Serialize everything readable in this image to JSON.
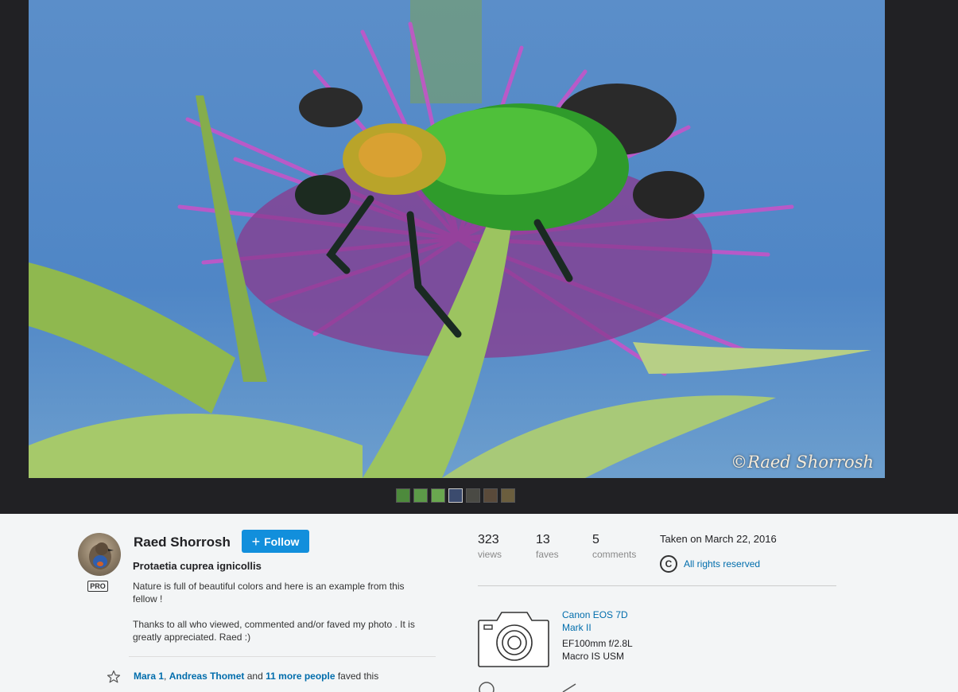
{
  "photo": {
    "watermark": "©Raed Shorrosh",
    "thumbnails": [
      "#4d8a3c",
      "#5c9a48",
      "#6aa84f",
      "#3b4b6e",
      "#4a4a44",
      "#5a4a3a",
      "#6b5e3e"
    ]
  },
  "owner": {
    "name": "Raed Shorrosh",
    "badge": "PRO",
    "follow_label": "Follow"
  },
  "title": "Protaetia cuprea ignicollis",
  "description": [
    "Nature is full of beautiful colors and here is an example from this fellow !",
    "Thanks to all who viewed, commented and/or faved my photo . It is greatly appreciated. Raed :)"
  ],
  "faves_line": {
    "user1": "Mara 1",
    "sep": ",",
    "user2": "Andreas Thomet",
    "and": "and",
    "more": "11 more people",
    "suffix": "faved this"
  },
  "stats": {
    "views": {
      "value": "323",
      "label": "views"
    },
    "faves": {
      "value": "13",
      "label": "faves"
    },
    "comments": {
      "value": "5",
      "label": "comments"
    }
  },
  "taken": "Taken on March 22, 2016",
  "license": {
    "icon": "C",
    "label": "All rights reserved"
  },
  "exif": {
    "camera": "Canon EOS 7D Mark II",
    "lens": "EF100mm f/2.8L Macro IS USM"
  },
  "colors": {
    "accent": "#128fdc",
    "link": "#006dac",
    "stage": "#212124"
  }
}
